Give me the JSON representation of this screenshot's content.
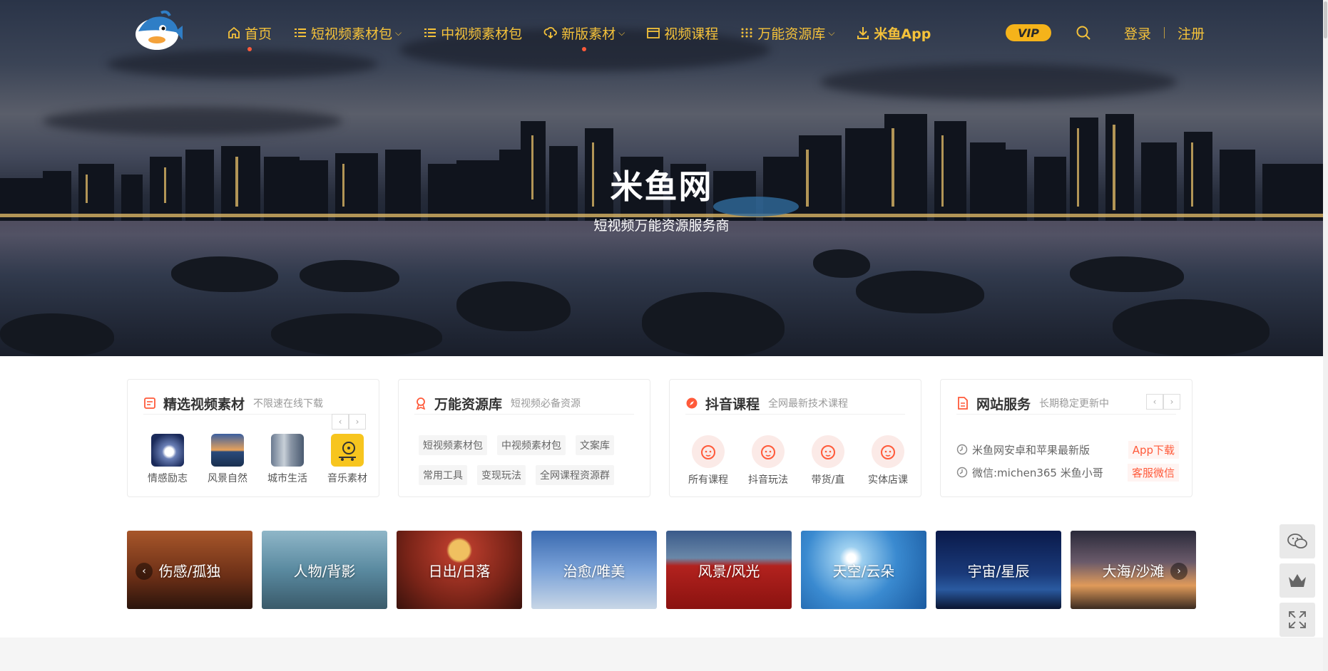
{
  "hero": {
    "title": "米鱼网",
    "subtitle": "短视频万能资源服务商"
  },
  "nav": {
    "items": [
      {
        "label": "首页",
        "icon": "home-icon",
        "active": true
      },
      {
        "label": "短视频素材包",
        "icon": "list-icon",
        "caret": true
      },
      {
        "label": "中视频素材包",
        "icon": "list-icon"
      },
      {
        "label": "新版素材",
        "icon": "cloud-download-icon",
        "caret": true,
        "dot": true
      },
      {
        "label": "视频课程",
        "icon": "window-icon"
      },
      {
        "label": "万能资源库",
        "icon": "grid-icon",
        "caret": true
      },
      {
        "label": "米鱼App",
        "icon": "download-icon",
        "bold": true
      }
    ],
    "vip": "VIP",
    "login": "登录",
    "register": "注册"
  },
  "cards": {
    "video": {
      "title": "精选视频素材",
      "subtitle": "不限速在线下载",
      "items": [
        "情感励志",
        "风景自然",
        "城市生活",
        "音乐素材"
      ]
    },
    "library": {
      "title": "万能资源库",
      "subtitle": "短视频必备资源",
      "tags": [
        "短视频素材包",
        "中视频素材包",
        "文案库",
        "常用工具",
        "变现玩法",
        "全网课程资源群"
      ]
    },
    "douyin": {
      "title": "抖音课程",
      "subtitle": "全网最新技术课程",
      "items": [
        "所有课程",
        "抖音玩法",
        "带货/直",
        "实体店课"
      ]
    },
    "service": {
      "title": "网站服务",
      "subtitle": "长期稳定更新中",
      "rows": [
        {
          "text": "米鱼网安卓和苹果最新版",
          "action": "App下载"
        },
        {
          "text": "微信:michen365 米鱼小哥",
          "action": "客服微信"
        }
      ]
    }
  },
  "categories": [
    "伤感/孤独",
    "人物/背影",
    "日出/日落",
    "治愈/唯美",
    "风景/风光",
    "天空/云朵",
    "宇宙/星辰",
    "大海/沙滩"
  ],
  "colors": {
    "accent": "#f5c23a",
    "red": "#ff5a3a",
    "vip": "#f5b31a"
  }
}
